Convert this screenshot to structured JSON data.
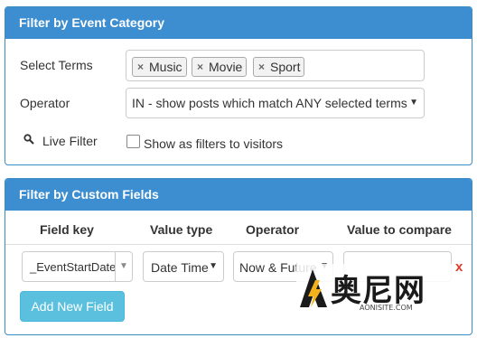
{
  "event_category": {
    "title": "Filter by Event Category",
    "select_terms_label": "Select Terms",
    "tags": [
      {
        "remove": "×",
        "label": "Music"
      },
      {
        "remove": "×",
        "label": "Movie"
      },
      {
        "remove": "×",
        "label": "Sport"
      }
    ],
    "operator_label": "Operator",
    "operator_value": "IN - show posts which match ANY selected terms",
    "live_filter_label": "Live Filter",
    "visitors_checkbox_label": "Show as filters to visitors"
  },
  "custom_fields": {
    "title": "Filter by Custom Fields",
    "headers": {
      "field_key": "Field key",
      "value_type": "Value type",
      "operator": "Operator",
      "value_to_compare": "Value to compare"
    },
    "row": {
      "field_key": "_EventStartDate",
      "value_type": "Date Time",
      "operator": "Now & Future",
      "value_to_compare": "",
      "remove": "x"
    },
    "add_button": "Add New Field"
  },
  "watermark": {
    "brand": "奥尼网",
    "site": "AONISITE.COM"
  },
  "colors": {
    "header_blue": "#3d8ed0",
    "button_info": "#5bc0de",
    "remove_red": "#e23b2e"
  },
  "icons": {
    "live_filter": "search-icon",
    "select_caret": "caret-down-icon"
  }
}
